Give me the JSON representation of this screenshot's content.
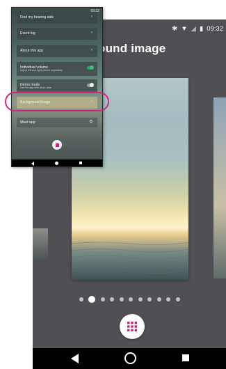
{
  "large_phone": {
    "status": {
      "time": "09:32"
    },
    "screen_title": "ound image",
    "page_indicator": {
      "total": 11,
      "active_index": 1
    },
    "fab_icon": "grid-icon",
    "colors": {
      "accent": "#c0267a",
      "background": "#4f4f54"
    }
  },
  "small_phone": {
    "status": {
      "left": "",
      "time": "09:32"
    },
    "menu": [
      {
        "label": "Find my hearing aids",
        "sub": "",
        "control": "chevron"
      },
      {
        "label": "Event log",
        "sub": "",
        "control": "chevron"
      },
      {
        "label": "About this app",
        "sub": "",
        "control": "chevron"
      },
      {
        "label": "Individual volume",
        "sub": "Adjust left and right volume separately",
        "control": "toggle-on"
      },
      {
        "label": "Demo mode",
        "sub": "Use the app with demo data",
        "control": "toggle-off"
      },
      {
        "label": "Background image",
        "sub": "",
        "control": "chevron",
        "highlighted": true
      },
      {
        "label": "Meet app",
        "sub": "",
        "control": "external"
      }
    ]
  }
}
